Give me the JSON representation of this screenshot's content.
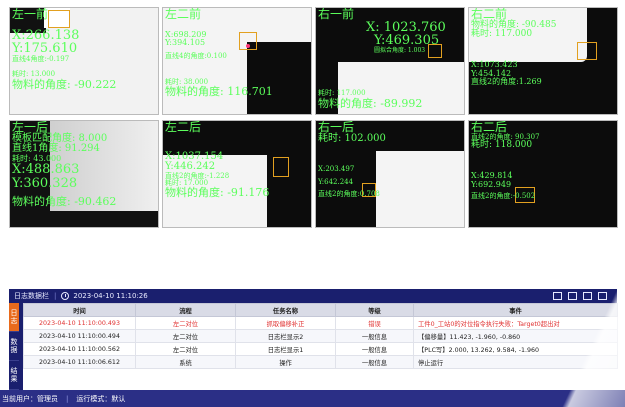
{
  "cameras": [
    {
      "lines": [
        "左一前",
        "X:266.138",
        "Y:175.610",
        "直线4角度:-0.197",
        "耗时: 13.000",
        "物料的角度: -90.222"
      ]
    },
    {
      "lines": [
        "左二前",
        "X:698.209",
        "Y:394.105",
        "直线4的角度:0.100",
        "耗时: 38.000",
        "物料的角度: 116.701"
      ]
    },
    {
      "lines": [
        "右一前",
        "X: 1023.760",
        "Y:469.305",
        "圆拟合角度: 1.003",
        "耗时: 117.000",
        "物料的角度: -89.992"
      ]
    },
    {
      "lines": [
        "右二前",
        "物料的角度: -90.485",
        "耗时: 117.000",
        "X:1073.423",
        "Y:454.142",
        "直线2的角度:1.269"
      ]
    },
    {
      "lines": [
        "左一后",
        "模板匹配角度: 8.000",
        "直线1角度: 91.294",
        "耗时: 43.000",
        "X:488.863",
        "Y:360.328",
        "物料的角度: -90.462"
      ]
    },
    {
      "lines": [
        "左二后",
        "X:1037.154",
        "Y:446.242",
        "直线2的角度:-1.228",
        "耗时: 17.000",
        "物料的角度: -91.176"
      ]
    },
    {
      "lines": [
        "右一后",
        "耗时: 102.000",
        "X:203.497",
        "Y:642.244",
        "直线2的角度:0.708"
      ]
    },
    {
      "lines": [
        "右二后",
        "直线2的角度: 90.307",
        "耗时: 118.000",
        "X:429.814",
        "Y:692.949",
        "直线2的角度:-0.502"
      ]
    }
  ],
  "log": {
    "title": "日志数据栏",
    "date": "2023-04-10 11:10:26",
    "side_tabs": [
      "日志",
      "数据",
      "结果"
    ],
    "columns": [
      "时间",
      "流程",
      "任务名称",
      "等级",
      "事件"
    ],
    "rows": [
      {
        "time": "2023-04-10 11:10:00.493",
        "flow": "左二对位",
        "task": "抓取偏移补正",
        "level": "错误",
        "event": "工件0_工站0的对位指令执行失败：Target0超出对"
      },
      {
        "time": "2023-04-10 11:10:00.494",
        "flow": "左二对位",
        "task": "日志栏显示2",
        "level": "一般信息",
        "event": "【偏移量】11.423, -1.960, -0.860"
      },
      {
        "time": "2023-04-10 11:10:00.562",
        "flow": "左二对位",
        "task": "日志栏显示1",
        "level": "一般信息",
        "event": "【PLC写】2.000, 13.262, 9.584, -1.960"
      },
      {
        "time": "2023-04-10 11:10:06.612",
        "flow": "系统",
        "task": "操作",
        "level": "一般信息",
        "event": "停止运行"
      }
    ]
  },
  "status": {
    "user": "当前用户：管理员",
    "mode": "运行模式：默认"
  },
  "colors": {
    "overlay_text": "#5cff5c",
    "error_text": "#e03030",
    "header_bar": "#1a1f6e",
    "active_tab": "#e86a1c"
  }
}
